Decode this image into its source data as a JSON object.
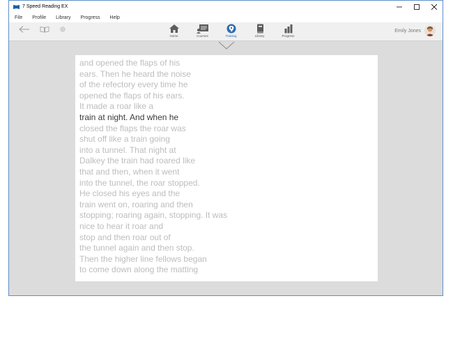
{
  "window": {
    "title": "7 Speed Reading EX"
  },
  "menu": {
    "items": [
      "File",
      "Profile",
      "Library",
      "Progress",
      "Help"
    ]
  },
  "nav": {
    "items": [
      {
        "label": "Home",
        "icon": "home-icon"
      },
      {
        "label": "Courses",
        "icon": "courses-icon"
      },
      {
        "label": "Training",
        "icon": "training-icon"
      },
      {
        "label": "Library",
        "icon": "library-icon"
      },
      {
        "label": "Progress",
        "icon": "progress-icon"
      }
    ],
    "active": "Training"
  },
  "user": {
    "name": "Emily Jones"
  },
  "colors": {
    "accent": "#2b6cb0",
    "window_border": "#5d8fc9",
    "text_dim": "#bdbdbd",
    "text_active": "#3a3a3a"
  },
  "reading": {
    "lines": [
      "and opened the flaps of his",
      "ears. Then he heard the noise",
      "of the refectory every time he",
      "opened the flaps of his ears.",
      "It made a roar like a",
      "train at night. And when he",
      "closed the flaps the roar was",
      "shut off like a train going",
      "into a tunnel. That night at",
      "Dalkey the train had roared like",
      "that and then, when it went",
      "into the tunnel, the roar stopped.",
      "He closed his eyes and the",
      "train went on, roaring and then",
      "stopping; roaring again, stopping. It was",
      "nice to hear it roar and",
      "stop and then roar out of",
      "the tunnel again and then stop.",
      "Then the higher line fellows began",
      "to come down along the matting"
    ],
    "active_line_index": 5
  }
}
